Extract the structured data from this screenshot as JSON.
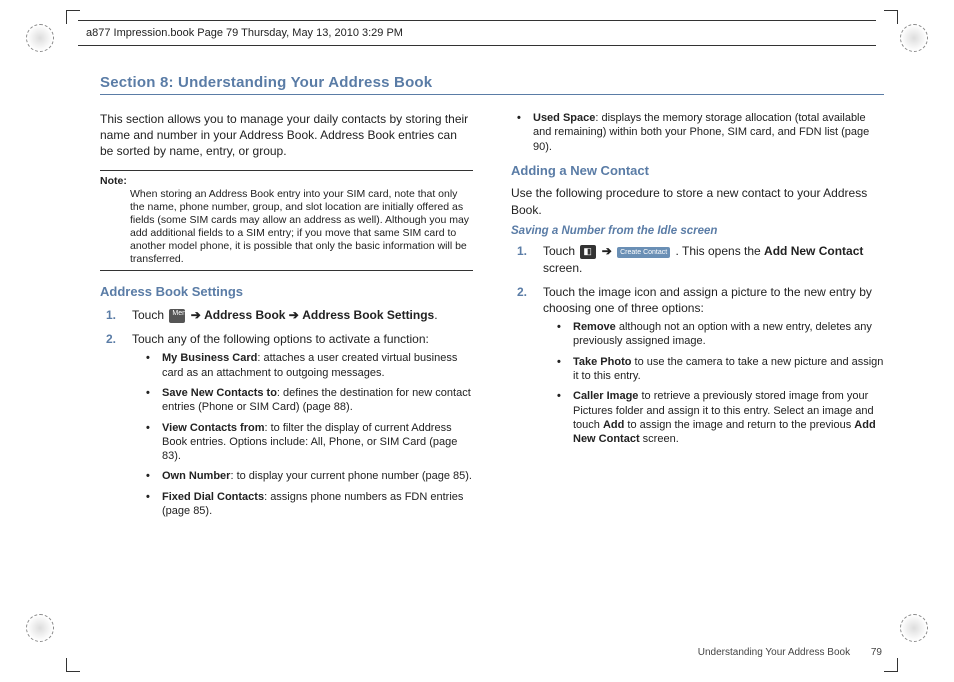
{
  "header": "a877 Impression.book  Page 79  Thursday, May 13, 2010  3:29 PM",
  "section_title": "Section 8: Understanding Your Address Book",
  "intro": "This section allows you to manage your daily contacts by storing their name and number in your Address Book. Address Book entries can be sorted by name, entry, or group.",
  "note_label": "Note:",
  "note_body": "When storing an Address Book entry into your SIM card, note that only the name, phone number, group, and slot location are initially offered as fields (some SIM cards may allow an address as well). Although you may add additional fields to a SIM entry; if you move that same SIM card to another model phone, it is possible that only the basic information will be transferred.",
  "h_settings": "Address Book Settings",
  "icons": {
    "menu": "Menu",
    "contacts": "Contacts",
    "create": "Create Contact",
    "arrow": "➔"
  },
  "settings_steps": {
    "s1_pre": "Touch ",
    "s1_a": " Address Book ",
    "s1_b": " Address Book Settings",
    "s2": "Touch any of the following options to activate a function:"
  },
  "settings_bullets": [
    {
      "b": "My Business Card",
      "t": ": attaches a user created virtual business card as an attachment to outgoing messages."
    },
    {
      "b": "Save New Contacts to",
      "t": ": defines the destination for new contact entries (Phone or SIM Card) (page 88)."
    },
    {
      "b": "View Contacts from",
      "t": ": to filter the display of current Address Book entries. Options include: All, Phone, or SIM Card (page 83)."
    },
    {
      "b": "Own Number",
      "t": ": to display your current phone number (page 85)."
    },
    {
      "b": "Fixed Dial Contacts",
      "t": ": assigns phone numbers as FDN entries (page 85)."
    }
  ],
  "used_space_b": "Used Space",
  "used_space_t": ": displays the memory storage allocation (total available and remaining) within both your Phone, SIM card, and FDN list (page 90).",
  "h_adding": "Adding a New Contact",
  "adding_intro": "Use the following procedure to store a new contact to your Address Book.",
  "h_saving": "Saving a Number from the Idle screen",
  "saving_s1_pre": "Touch ",
  "saving_s1_mid": ". This opens the ",
  "saving_s1_b": "Add New Contact",
  "saving_s1_end": " screen.",
  "saving_s2": "Touch the image icon and assign a picture to the new entry by choosing one of three options:",
  "saving_bullets": [
    {
      "b": "Remove",
      "t": " although not an option with a new entry, deletes any previously assigned image."
    },
    {
      "b": "Take Photo",
      "t": " to use the camera to take a new picture and assign it to this entry."
    },
    {
      "b": "Caller Image",
      "t": " to retrieve a previously stored image from your Pictures folder and assign it to this entry. Select an image and touch ",
      "b2": "Add",
      "t2": " to assign the image and return to the previous ",
      "b3": "Add New Contact",
      "t3": " screen."
    }
  ],
  "footer_text": "Understanding Your Address Book",
  "footer_page": "79",
  "nums": {
    "1": "1.",
    "2": "2."
  }
}
